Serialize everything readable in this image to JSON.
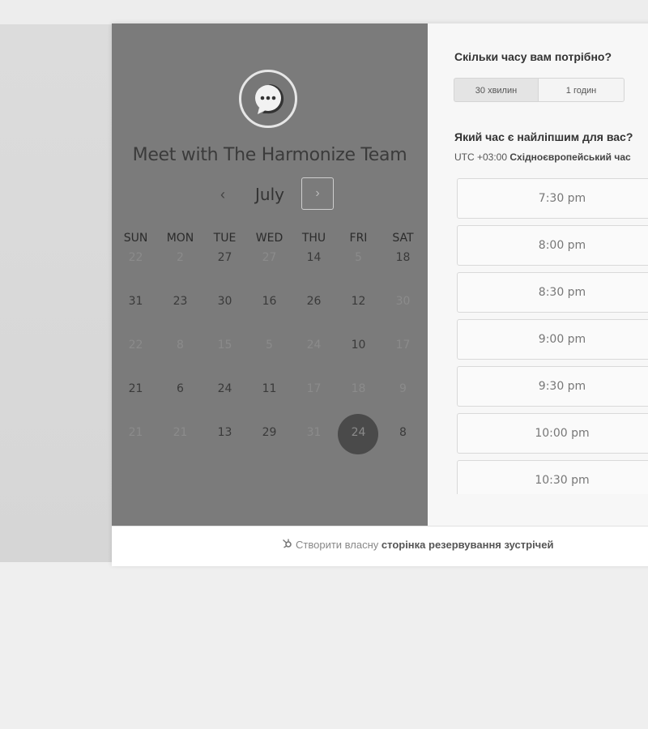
{
  "profile": {
    "title": "Meet with The Harmonize Team"
  },
  "calendar": {
    "prev_icon": "‹",
    "next_icon": "›",
    "month": "July",
    "weekdays": [
      "SUN",
      "MON",
      "TUE",
      "WED",
      "THU",
      "FRI",
      "SAT"
    ],
    "weeks": [
      [
        {
          "d": "22",
          "s": "dim"
        },
        {
          "d": "2",
          "s": "dim"
        },
        {
          "d": "27",
          "s": ""
        },
        {
          "d": "27",
          "s": "dim"
        },
        {
          "d": "14",
          "s": ""
        },
        {
          "d": "5",
          "s": "dim"
        },
        {
          "d": "18",
          "s": ""
        }
      ],
      [
        {
          "d": "31",
          "s": ""
        },
        {
          "d": "23",
          "s": ""
        },
        {
          "d": "30",
          "s": ""
        },
        {
          "d": "16",
          "s": ""
        },
        {
          "d": "26",
          "s": ""
        },
        {
          "d": "12",
          "s": ""
        },
        {
          "d": "30",
          "s": "dim"
        }
      ],
      [
        {
          "d": "22",
          "s": "dim"
        },
        {
          "d": "8",
          "s": "dim"
        },
        {
          "d": "15",
          "s": "dim"
        },
        {
          "d": "5",
          "s": "dim"
        },
        {
          "d": "24",
          "s": "dim"
        },
        {
          "d": "10",
          "s": ""
        },
        {
          "d": "17",
          "s": "dim"
        }
      ],
      [
        {
          "d": "21",
          "s": ""
        },
        {
          "d": "6",
          "s": ""
        },
        {
          "d": "24",
          "s": ""
        },
        {
          "d": "11",
          "s": ""
        },
        {
          "d": "17",
          "s": "dim"
        },
        {
          "d": "18",
          "s": "dim"
        },
        {
          "d": "9",
          "s": "dim"
        }
      ],
      [
        {
          "d": "21",
          "s": "dim"
        },
        {
          "d": "21",
          "s": "dim"
        },
        {
          "d": "13",
          "s": ""
        },
        {
          "d": "29",
          "s": ""
        },
        {
          "d": "31",
          "s": "dim"
        },
        {
          "d": "24",
          "s": "sel"
        },
        {
          "d": "8",
          "s": ""
        }
      ]
    ]
  },
  "booking": {
    "duration_question": "Скільки часу вам потрібно?",
    "durations": [
      "30 хвилин",
      "1 годин"
    ],
    "time_question": "Який час є найліпшим для вас?",
    "timezone_prefix": "UTC +03:00",
    "timezone_name": "Східноєвропейський час",
    "slots": [
      "7:30 pm",
      "8:00 pm",
      "8:30 pm",
      "9:00 pm",
      "9:30 pm",
      "10:00 pm",
      "10:30 pm"
    ]
  },
  "footer": {
    "prefix": "Створити власну",
    "bold": "сторінка резервування зустрічей"
  },
  "colors": {
    "left_panel": "#7b7b7b",
    "selected_day": "#4a4a4a"
  }
}
